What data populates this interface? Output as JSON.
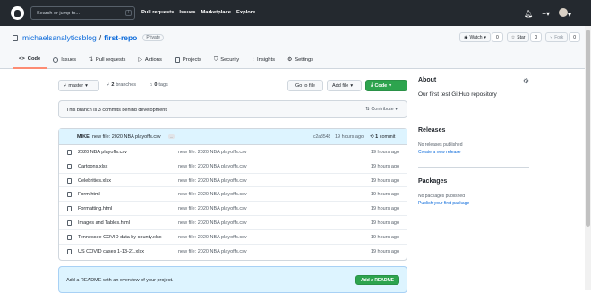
{
  "header": {
    "search_placeholder": "Search or jump to...",
    "search_shortcut": "/",
    "nav": [
      "Pull requests",
      "Issues",
      "Marketplace",
      "Explore"
    ],
    "notification_icon": "bell-icon",
    "plus_label": "+▾",
    "avatar_caret": "▾"
  },
  "repo": {
    "owner": "michaelsanalyticsblog",
    "separator": "/",
    "name": "first-repo",
    "visibility": "Private",
    "watch_label": "Watch",
    "watch_count": "0",
    "star_label": "Star",
    "star_count": "0",
    "fork_label": "Fork",
    "fork_count": "0"
  },
  "tabs": [
    {
      "label": "Code",
      "icon": "code-icon"
    },
    {
      "label": "Issues",
      "icon": "issue-icon"
    },
    {
      "label": "Pull requests",
      "icon": "pull-request-icon"
    },
    {
      "label": "Actions",
      "icon": "play-icon"
    },
    {
      "label": "Projects",
      "icon": "table-icon"
    },
    {
      "label": "Security",
      "icon": "shield-icon"
    },
    {
      "label": "Insights",
      "icon": "graph-icon"
    },
    {
      "label": "Settings",
      "icon": "gear-icon"
    }
  ],
  "controls": {
    "branch": "master",
    "branches_count": "2",
    "branches_label": "branches",
    "tags_count": "0",
    "tags_label": "tags",
    "goto_file": "Go to file",
    "add_file": "Add file",
    "code_button": "Code"
  },
  "behind_notice": "This branch is 3 commits behind development.",
  "contribute": "Contribute",
  "latest_commit": {
    "author": "MIKE",
    "message": "new file: 2020 NBA playoffs.csv",
    "ellipsis": "...",
    "sha": "c2a8548",
    "when": "19 hours ago",
    "commit_count": "1",
    "commit_label": "commit"
  },
  "files": [
    {
      "name": "2020 NBA playoffs.csv",
      "message": "new file: 2020 NBA playoffs.csv",
      "age": "19 hours ago"
    },
    {
      "name": "Cartoons.xlsx",
      "message": "new file: 2020 NBA playoffs.csv",
      "age": "19 hours ago"
    },
    {
      "name": "Celebrities.xlsx",
      "message": "new file: 2020 NBA playoffs.csv",
      "age": "19 hours ago"
    },
    {
      "name": "Form.html",
      "message": "new file: 2020 NBA playoffs.csv",
      "age": "19 hours ago"
    },
    {
      "name": "Formatting.html",
      "message": "new file: 2020 NBA playoffs.csv",
      "age": "19 hours ago"
    },
    {
      "name": "Images and Tables.html",
      "message": "new file: 2020 NBA playoffs.csv",
      "age": "19 hours ago"
    },
    {
      "name": "Tennessee COVID data by county.xlsx",
      "message": "new file: 2020 NBA playoffs.csv",
      "age": "19 hours ago"
    },
    {
      "name": "US COVID cases 1-13-21.xlsx",
      "message": "new file: 2020 NBA playoffs.csv",
      "age": "19 hours ago"
    }
  ],
  "readme": {
    "prompt": "Add a README with an overview of your project.",
    "button": "Add a README"
  },
  "sidebar": {
    "about_title": "About",
    "about_desc": "Our first test GitHub repository",
    "releases_title": "Releases",
    "releases_none": "No releases published",
    "releases_link": "Create a new release",
    "packages_title": "Packages",
    "packages_none": "No packages published",
    "packages_link": "Publish your first package"
  }
}
